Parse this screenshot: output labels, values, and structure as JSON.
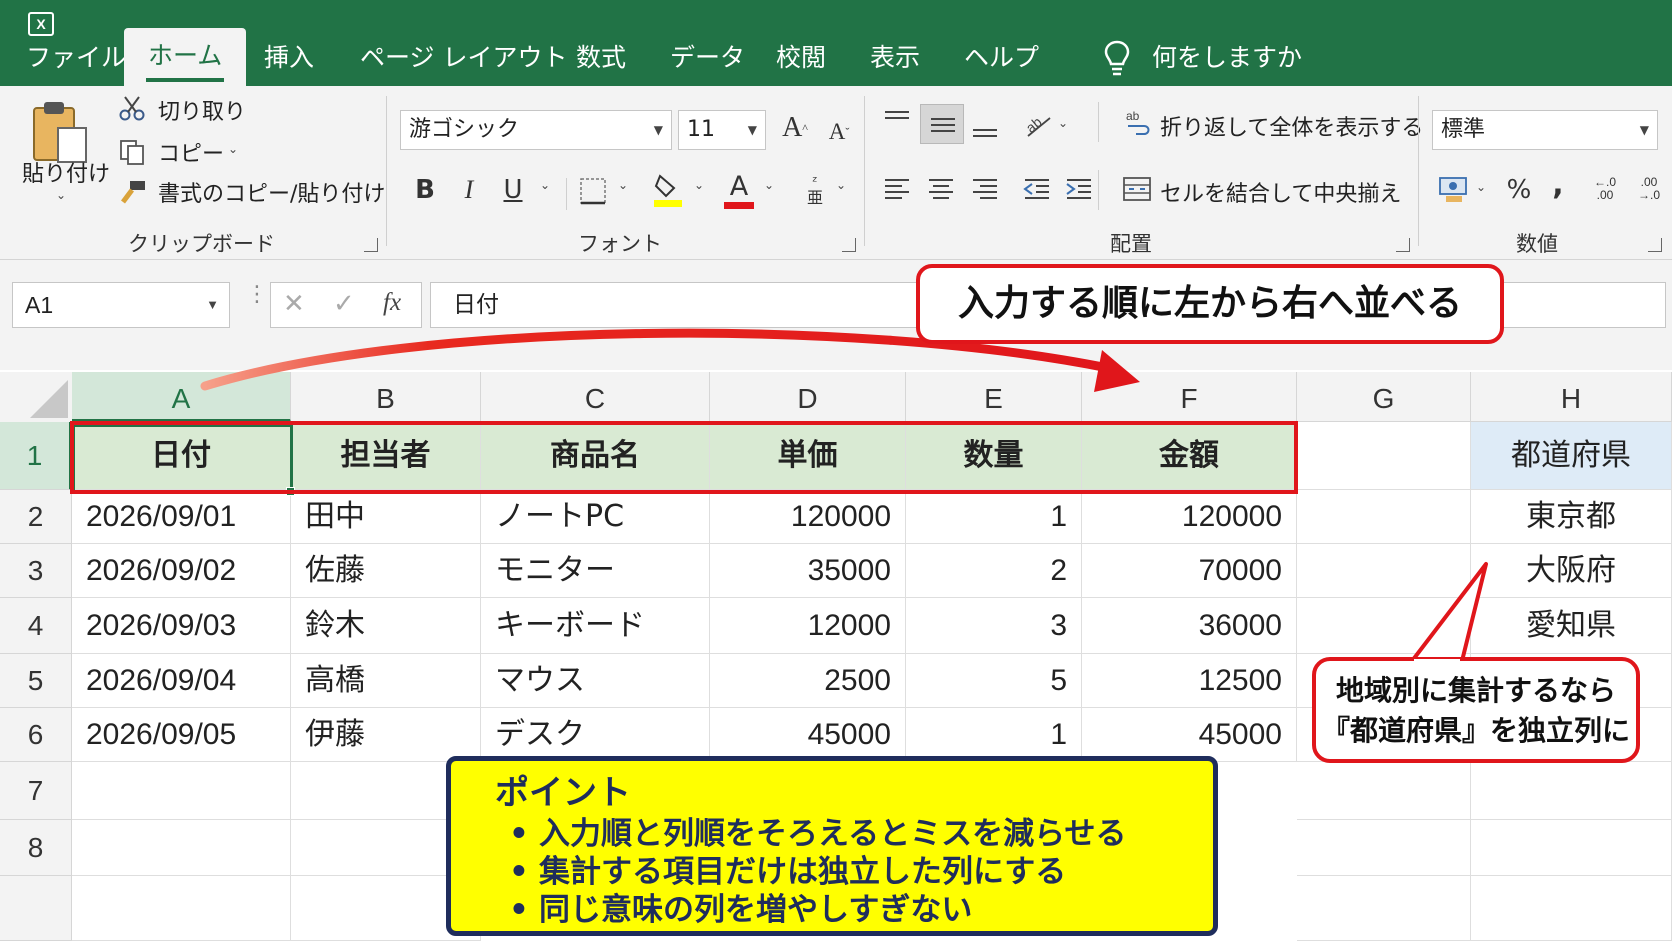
{
  "app": {
    "icon_text": "X"
  },
  "tabs": [
    {
      "label": "ファイル"
    },
    {
      "label": "ホーム"
    },
    {
      "label": "挿入"
    },
    {
      "label": "ページ レイアウト"
    },
    {
      "label": "数式"
    },
    {
      "label": "データ"
    },
    {
      "label": "校閲"
    },
    {
      "label": "表示"
    },
    {
      "label": "ヘルプ"
    }
  ],
  "tell_me": "何をしますか",
  "clipboard": {
    "paste": "貼り付け",
    "cut": "切り取り",
    "copy": "コピー",
    "format_painter": "書式のコピー/貼り付け",
    "label": "クリップボード"
  },
  "font": {
    "name": "游ゴシック",
    "size": "11",
    "bold": "B",
    "italic": "I",
    "underline": "U",
    "label": "フォント"
  },
  "alignment": {
    "wrap": "折り返して全体を表示する",
    "merge": "セルを結合して中央揃え",
    "label": "配置"
  },
  "number": {
    "format": "標準",
    "percent": "%",
    "comma": ",",
    "label": "数値"
  },
  "formula_bar": {
    "name_box": "A1",
    "content": "日付"
  },
  "columns": [
    "A",
    "B",
    "C",
    "D",
    "E",
    "F",
    "G",
    "H"
  ],
  "rows": [
    "1",
    "2",
    "3",
    "4",
    "5",
    "6",
    "7",
    "8"
  ],
  "table": {
    "headers": [
      "日付",
      "担当者",
      "商品名",
      "単価",
      "数量",
      "金額"
    ],
    "rows": [
      [
        "2026/09/01",
        "田中",
        "ノートPC",
        "120000",
        "1",
        "120000"
      ],
      [
        "2026/09/02",
        "佐藤",
        "モニター",
        "35000",
        "2",
        "70000"
      ],
      [
        "2026/09/03",
        "鈴木",
        "キーボード",
        "12000",
        "3",
        "36000"
      ],
      [
        "2026/09/04",
        "高橋",
        "マウス",
        "2500",
        "5",
        "12500"
      ],
      [
        "2026/09/05",
        "伊藤",
        "デスク",
        "45000",
        "1",
        "45000"
      ]
    ]
  },
  "prefecture": {
    "header": "都道府県",
    "values": [
      "東京都",
      "大阪府",
      "愛知県"
    ]
  },
  "callouts": {
    "order": "入力する順に左から右へ並べる",
    "region_line1": "地域別に集計するなら",
    "region_line2": "『都道府県』を独立列に"
  },
  "point": {
    "title": "ポイント",
    "items": [
      "入力順と列順をそろえるとミスを減らせる",
      "集計する項目だけは独立した列にする",
      "同じ意味の列を増やしすぎない"
    ]
  },
  "colors": {
    "excel_green": "#217346",
    "header_fill": "#d9ead3",
    "pref_fill": "#deebf7",
    "callout_red": "#e0161b",
    "point_yellow": "#ffff00",
    "point_navy": "#1f2d5c"
  }
}
